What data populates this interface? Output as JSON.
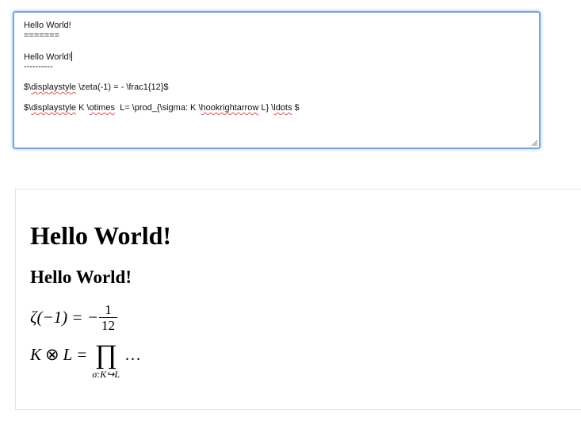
{
  "editor": {
    "lines": [
      "Hello World!",
      "=======",
      "",
      "Hello World!",
      "----------",
      "",
      "$\\displaystyle \\zeta(-1) = - \\frac1{12}$",
      "",
      "$\\displaystyle K \\otimes  L= \\prod_{\\sigma: K \\hookrightarrow L} \\ldots $"
    ]
  },
  "preview": {
    "h1": "Hello World!",
    "h2": "Hello World!",
    "eq1": {
      "lhs": "ζ(−1) = −",
      "num": "1",
      "den": "12"
    },
    "eq2": {
      "lhs_k": "K",
      "otimes": "⊗",
      "lhs_l": "L =",
      "prod": "∏",
      "sub": "σ:K↪L",
      "dots": "…"
    }
  }
}
